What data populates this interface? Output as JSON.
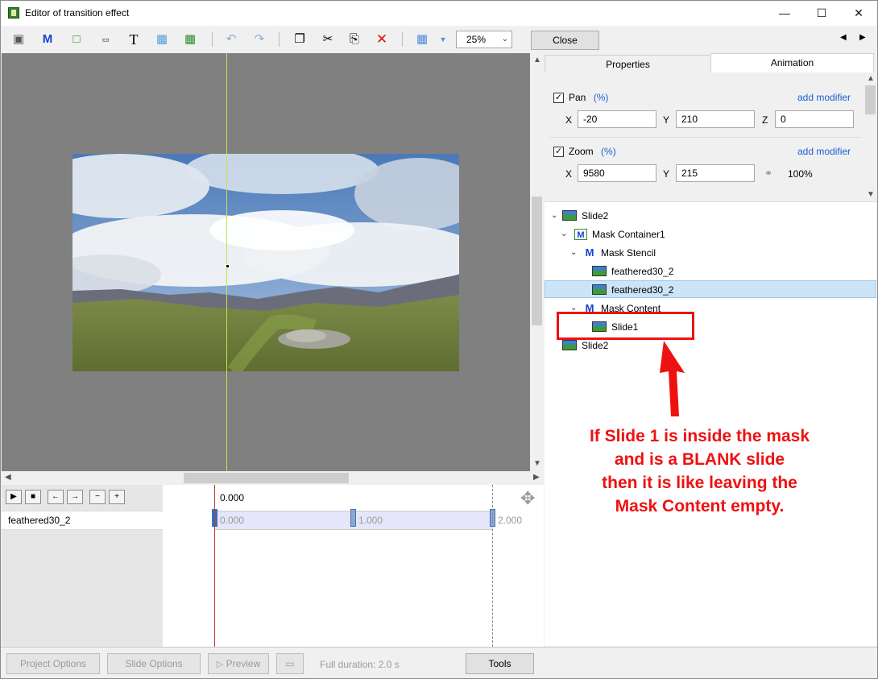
{
  "window": {
    "title": "Editor of transition effect"
  },
  "toolbar": {
    "zoom_value": "25%",
    "close_label": "Close"
  },
  "timeline": {
    "current_time": "0.000",
    "track_name": "feathered30_2",
    "keyframes": [
      "0.000",
      "1.000",
      "2.000"
    ]
  },
  "tabs": {
    "properties": "Properties",
    "animation": "Animation"
  },
  "animation": {
    "pan": {
      "label": "Pan",
      "unit": "(%)",
      "checked": true,
      "modifier": "add modifier",
      "x": "-20",
      "y": "210",
      "z": "0"
    },
    "zoom": {
      "label": "Zoom",
      "unit": "(%)",
      "checked": true,
      "modifier": "add modifier",
      "x": "9580",
      "y": "215",
      "percent": "100%"
    },
    "axis_x": "X",
    "axis_y": "Y",
    "axis_z": "Z"
  },
  "tree": {
    "items": [
      {
        "label": "Slide2",
        "icon": "image-icon"
      },
      {
        "label": "Mask Container1",
        "icon": "mask-container-icon"
      },
      {
        "label": "Mask Stencil",
        "icon": "mask-stencil-icon"
      },
      {
        "label": "feathered30_2",
        "icon": "image-icon"
      },
      {
        "label": "feathered30_2",
        "icon": "image-icon",
        "selected": true
      },
      {
        "label": "Mask Content",
        "icon": "mask-content-icon"
      },
      {
        "label": "Slide1",
        "icon": "image-icon"
      },
      {
        "label": "Slide2",
        "icon": "image-icon"
      }
    ]
  },
  "annotation": {
    "lines": [
      "If Slide 1 is inside the mask",
      "and is a BLANK slide",
      "then it is like leaving the",
      "Mask Content empty."
    ],
    "color": "#ee1111"
  },
  "bottom": {
    "project_options": "Project Options",
    "slide_options": "Slide Options",
    "preview": "Preview",
    "full_duration": "Full duration: 2.0 s",
    "tools": "Tools"
  }
}
